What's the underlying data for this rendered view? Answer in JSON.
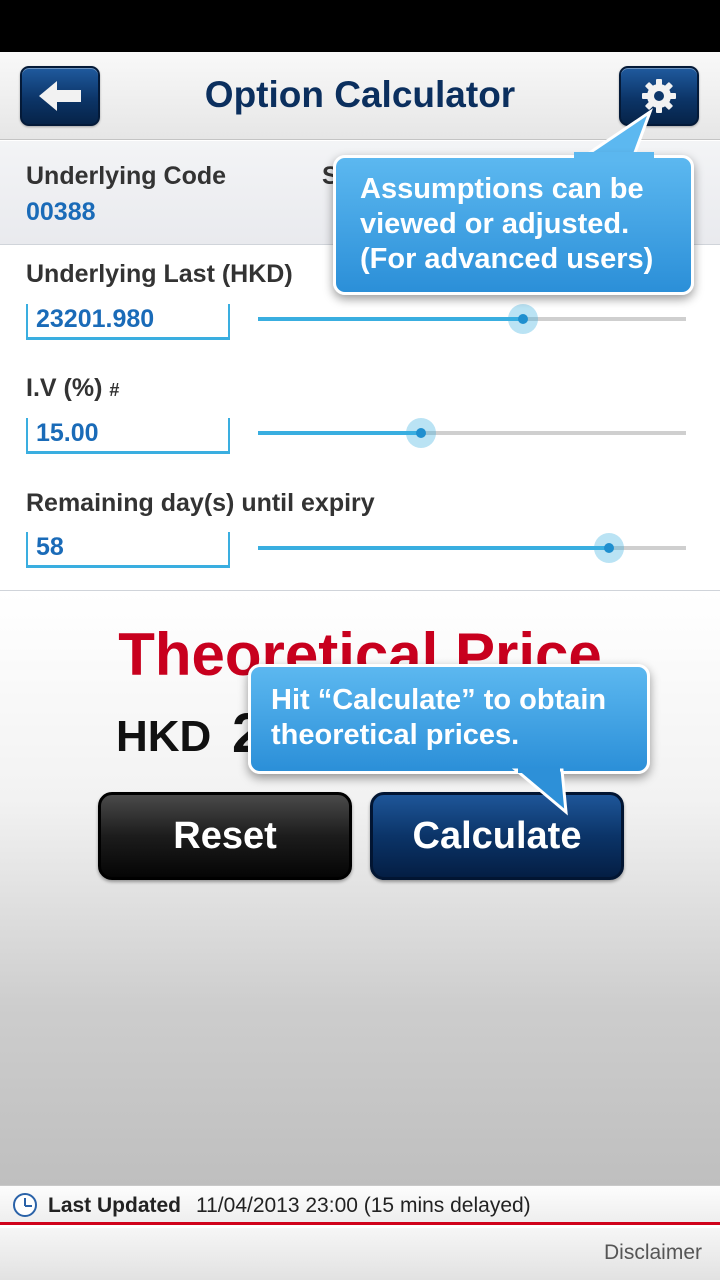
{
  "header": {
    "title": "Option Calculator",
    "back_icon": "back-arrow-icon",
    "settings_icon": "gear-icon"
  },
  "underlying": {
    "code_label": "Underlying Code",
    "code_value": "00388",
    "second_label_partial": "S"
  },
  "fields": [
    {
      "label": "Underlying Last (HKD)",
      "suffix": "",
      "value": "23201.980",
      "slider_fraction": 0.62
    },
    {
      "label": "I.V (%)",
      "suffix": "#",
      "value": "15.00",
      "slider_fraction": 0.38
    },
    {
      "label": "Remaining day(s) until expiry",
      "suffix": "",
      "value": "58",
      "slider_fraction": 0.82
    }
  ],
  "result": {
    "title": "Theoretical Price",
    "currency": "HKD",
    "value_partial": "2"
  },
  "buttons": {
    "reset": "Reset",
    "calculate": "Calculate"
  },
  "tooltips": {
    "settings_line1": "Assumptions can be",
    "settings_line2": "viewed or adjusted.",
    "settings_line3": "(For advanced users)",
    "calculate_line1": "Hit “Calculate” to obtain",
    "calculate_line2": "theoretical prices."
  },
  "footer": {
    "updated_label": "Last Updated",
    "updated_value": "11/04/2013 23:00 (15 mins delayed)",
    "disclaimer": "Disclaimer",
    "clock_icon": "clock-icon"
  },
  "colors": {
    "accent_blue": "#1a6bb8",
    "nav_dark_blue": "#0b2f5e",
    "slider_blue": "#39aee0",
    "result_red": "#c8001e",
    "tooltip_blue": "#2b8fd8",
    "footer_red": "#d0021b"
  }
}
